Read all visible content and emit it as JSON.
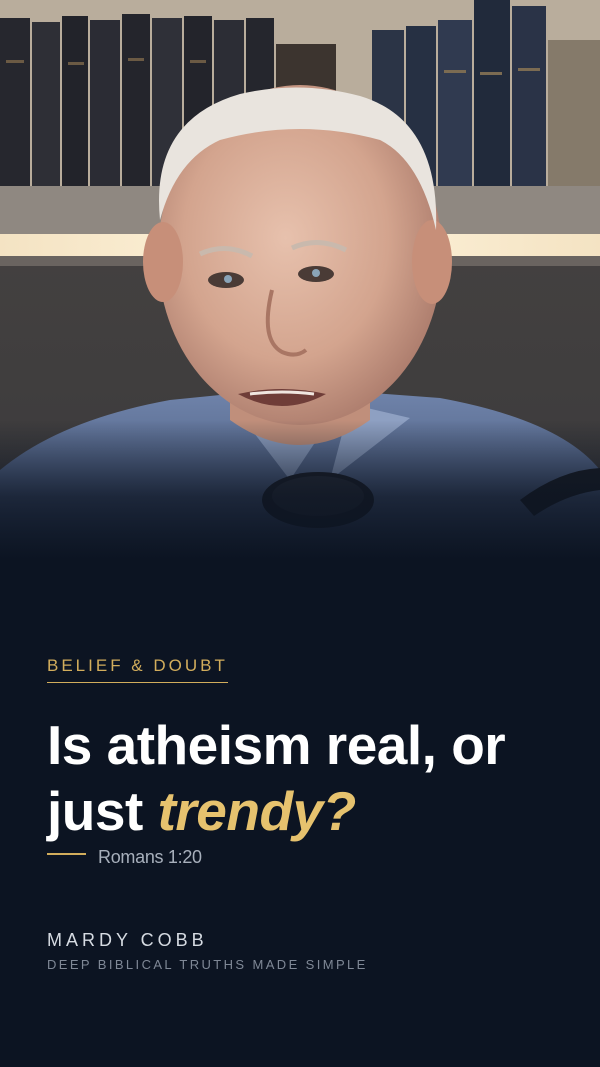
{
  "video": {
    "subject": "man speaking in front of bookshelf"
  },
  "overlay": {
    "kicker": "BELIEF & DOUBT",
    "headline_main": "Is atheism real, or just ",
    "headline_accent": "trendy?",
    "scripture_ref": "Romans 1:20",
    "author_name": "MARDY COBB",
    "tagline": "DEEP BIBLICAL TRUTHS MADE SIMPLE"
  },
  "colors": {
    "background": "#0c1422",
    "accent_gold": "#d2ad5c",
    "headline": "#ffffff"
  }
}
